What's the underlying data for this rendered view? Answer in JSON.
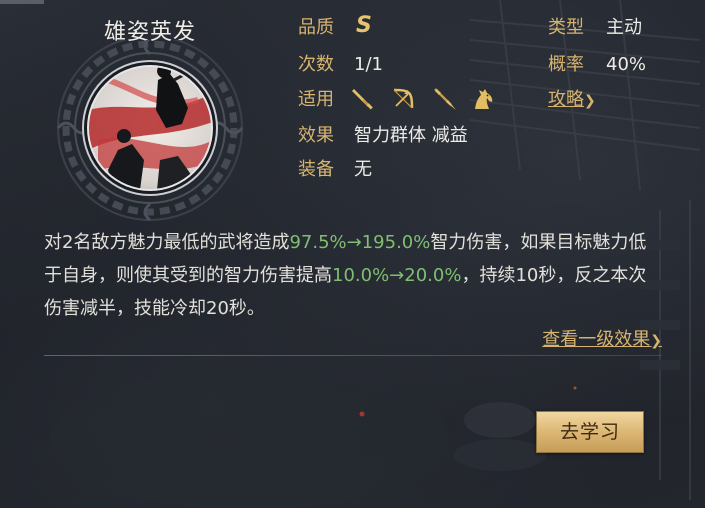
{
  "skill": {
    "name": "雄姿英发"
  },
  "attributes": {
    "quality_label": "品质",
    "quality_value": "S",
    "uses_label": "次数",
    "uses_value": "1/1",
    "applicable_label": "适用",
    "applicable_units": [
      "sword-icon",
      "bow-icon",
      "spear-icon",
      "horse-icon"
    ],
    "effect_label": "效果",
    "effect_value": "智力群体 减益",
    "equipment_label": "装备",
    "equipment_value": "无",
    "type_label": "类型",
    "type_value": "主动",
    "chance_label": "概率",
    "chance_value": "40%",
    "guide_label": "攻略",
    "guide_chevron": "❯"
  },
  "description": {
    "part1": "对2名敌方魅力最低的武将造成",
    "damage_range": "97.5%→195.0%",
    "part2": "智力伤害，如果目标魅力低于自身，则使其受到的智力伤害提高",
    "boost_range": "10.0%→20.0%",
    "part3": "，持续10秒，反之本次伤害减半，技能冷却20秒。"
  },
  "level_link": {
    "label": "查看一级效果",
    "chevron": "❯"
  },
  "learn_button": {
    "label": "去学习"
  },
  "colors": {
    "label_gold": "#d6b470",
    "highlight_green": "#7fbf72",
    "button_gold": "#dcb774"
  }
}
